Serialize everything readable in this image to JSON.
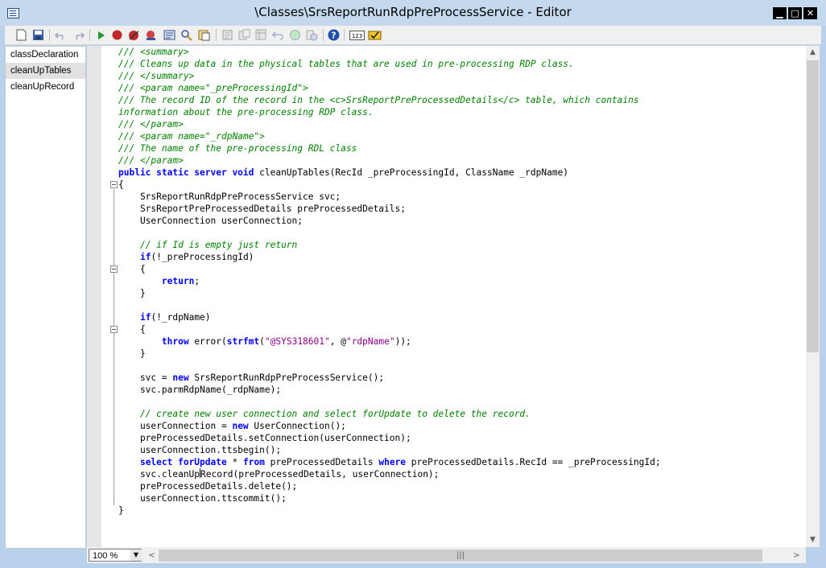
{
  "window": {
    "title": "\\Classes\\SrsReportRunRdpPreProcessService - Editor",
    "min_label": "▁",
    "max_label": "□",
    "close_label": "✕"
  },
  "toolbar": {
    "icons": [
      "new-icon",
      "save-icon",
      "undo-icon",
      "redo-icon",
      "run-icon",
      "breakpoint-icon",
      "remove-breakpoints-icon",
      "toggle-breakpoint-icon",
      "compile-icon",
      "find-icon",
      "lookup-icon",
      "properties-icon",
      "list-fields-icon",
      "list-tables-icon",
      "scripts-icon",
      "source-control-icon",
      "compare-icon",
      "help-icon",
      "numbering-icon",
      "best-practices-icon"
    ]
  },
  "methods": {
    "items": [
      {
        "label": "classDeclaration",
        "selected": false
      },
      {
        "label": "cleanUpTables",
        "selected": true
      },
      {
        "label": "cleanUpRecord",
        "selected": false
      }
    ]
  },
  "code": {
    "lines": [
      [
        {
          "t": "/// <summary>",
          "c": "cm"
        }
      ],
      [
        {
          "t": "/// Cleans up data in the physical tables that are used in pre-processing RDP class.",
          "c": "cm"
        }
      ],
      [
        {
          "t": "/// </summary>",
          "c": "cm"
        }
      ],
      [
        {
          "t": "/// <param name=\"_preProcessingId\">",
          "c": "cm"
        }
      ],
      [
        {
          "t": "/// The record ID of the record in the <c>SrsReportPreProcessedDetails</c> table, which contains",
          "c": "cm"
        }
      ],
      [
        {
          "t": "information about the pre-processing RDP class.",
          "c": "cm"
        }
      ],
      [
        {
          "t": "/// </param>",
          "c": "cm"
        }
      ],
      [
        {
          "t": "/// <param name=\"_rdpName\">",
          "c": "cm"
        }
      ],
      [
        {
          "t": "/// The name of the pre-processing RDL class",
          "c": "cm"
        }
      ],
      [
        {
          "t": "/// </param>",
          "c": "cm"
        }
      ],
      [
        {
          "t": "public static server void",
          "c": "kw"
        },
        {
          "t": " cleanUpTables(RecId _preProcessingId, ClassName _rdpName)"
        }
      ],
      [
        {
          "t": "{"
        }
      ],
      [
        {
          "t": "    SrsReportRunRdpPreProcessService svc;"
        }
      ],
      [
        {
          "t": "    SrsReportPreProcessedDetails preProcessedDetails;"
        }
      ],
      [
        {
          "t": "    UserConnection userConnection;"
        }
      ],
      [
        {
          "t": ""
        }
      ],
      [
        {
          "t": "    "
        },
        {
          "t": "// if Id is empty just return",
          "c": "cm"
        }
      ],
      [
        {
          "t": "    "
        },
        {
          "t": "if",
          "c": "kw"
        },
        {
          "t": "(!_preProcessingId)"
        }
      ],
      [
        {
          "t": "    {"
        }
      ],
      [
        {
          "t": "        "
        },
        {
          "t": "return",
          "c": "kw"
        },
        {
          "t": ";"
        }
      ],
      [
        {
          "t": "    }"
        }
      ],
      [
        {
          "t": ""
        }
      ],
      [
        {
          "t": "    "
        },
        {
          "t": "if",
          "c": "kw"
        },
        {
          "t": "(!_rdpName)"
        }
      ],
      [
        {
          "t": "    {"
        }
      ],
      [
        {
          "t": "        "
        },
        {
          "t": "throw",
          "c": "kw"
        },
        {
          "t": " error("
        },
        {
          "t": "strfmt",
          "c": "kw"
        },
        {
          "t": "("
        },
        {
          "t": "\"@SYS318601\"",
          "c": "st"
        },
        {
          "t": ", @"
        },
        {
          "t": "\"rdpName\"",
          "c": "st"
        },
        {
          "t": "));"
        }
      ],
      [
        {
          "t": "    }"
        }
      ],
      [
        {
          "t": ""
        }
      ],
      [
        {
          "t": "    svc = "
        },
        {
          "t": "new",
          "c": "kw"
        },
        {
          "t": " SrsReportRunRdpPreProcessService();"
        }
      ],
      [
        {
          "t": "    svc.parmRdpName(_rdpName);"
        }
      ],
      [
        {
          "t": ""
        }
      ],
      [
        {
          "t": "    "
        },
        {
          "t": "// create new user connection and select forUpdate to delete the record.",
          "c": "cm"
        }
      ],
      [
        {
          "t": "    userConnection = "
        },
        {
          "t": "new",
          "c": "kw"
        },
        {
          "t": " UserConnection();"
        }
      ],
      [
        {
          "t": "    preProcessedDetails.setConnection(userConnection);"
        }
      ],
      [
        {
          "t": "    userConnection.ttsbegin();"
        }
      ],
      [
        {
          "t": "    "
        },
        {
          "t": "select forUpdate",
          "c": "kw"
        },
        {
          "t": " * "
        },
        {
          "t": "from",
          "c": "kw"
        },
        {
          "t": " preProcessedDetails "
        },
        {
          "t": "where",
          "c": "kw"
        },
        {
          "t": " preProcessedDetails.RecId == _preProcessingId;"
        }
      ],
      [
        {
          "t": "    svc.cleanUp"
        },
        {
          "t": "",
          "c": "caret"
        },
        {
          "t": "Record(preProcessedDetails, userConnection);"
        }
      ],
      [
        {
          "t": "    preProcessedDetails.delete();"
        }
      ],
      [
        {
          "t": "    userConnection.ttscommit();"
        }
      ],
      [
        {
          "t": "}"
        }
      ]
    ]
  },
  "status": {
    "zoom": "100 %"
  }
}
